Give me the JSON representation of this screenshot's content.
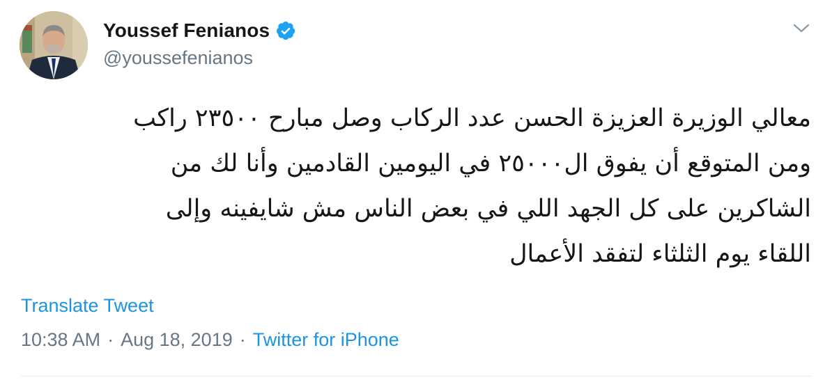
{
  "author": {
    "display_name": "Youssef Fenianos",
    "handle": "@youssefenianos",
    "verified": true
  },
  "tweet": {
    "text_lines": [
      "معالي الوزيرة العزيزة الحسن عدد الركاب وصل مبارح ٢٣٥٠٠ راكب",
      "ومن المتوقع أن يفوق ال٢٥٠٠٠ في اليومين القادمين وأنا لك من",
      "الشاكرين على كل الجهد اللي في بعض الناس مش شايفينه وإلى",
      "اللقاء يوم الثلثاء لتفقد الأعمال"
    ],
    "translate_label": "Translate Tweet",
    "time": "10:38 AM",
    "separator_1": "·",
    "date": "Aug 18, 2019",
    "separator_2": "·",
    "source": "Twitter for iPhone"
  },
  "icons": {
    "verified": "verified-badge-icon",
    "caret": "chevron-down-icon"
  },
  "colors": {
    "link": "#1b95e0",
    "secondary_text": "#657786",
    "primary_text": "#14171a",
    "verified_badge": "#1da1f2"
  }
}
